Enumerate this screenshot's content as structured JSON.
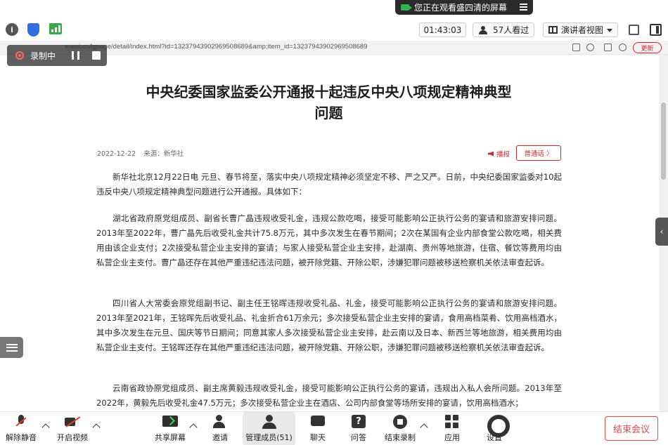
{
  "banner": {
    "text": "您正在观看盛四清的屏幕"
  },
  "header": {
    "timer": "01:43:03",
    "viewers": "57人看过",
    "view_mode": "演讲者视图"
  },
  "browser": {
    "url": "xuexi.cn/lgpage/detail/index.html?id=13237943902969508689&amp;item_id=13237943902969508689",
    "update_label": "更新"
  },
  "recording": {
    "label": "录制中"
  },
  "article": {
    "title_line1": "中央纪委国家监委公开通报十起违反中央八项规定精神典型",
    "title_line2": "问题",
    "date": "2022-12-22",
    "source": "来源：新华社",
    "audio_label": "播报",
    "mandarin_label": "普通话 〉",
    "paragraphs": [
      "新华社北京12月22日电 元旦、春节将至，落实中央八项规定精神必须坚定不移、严之又严。日前，中央纪委国家监委对10起违反中央八项规定精神典型问题进行公开通报。具体如下：",
      "湖北省政府原党组成员、副省长曹广晶违规收受礼金，违规公款吃喝，接受可能影响公正执行公务的宴请和旅游安排问题。2013年至2022年，曹广晶先后收受礼金共计75.8万元，其中多次发生在春节期间；2次在某国有企业内部食堂公款吃喝，相关费用由该企业支付；2次接受私营企业主安排的宴请；与家人接受私营企业主安排，赴湖南、贵州等地旅游，住宿、餐饮等费用均由私营企业主支付。曹广晶还存在其他严重违纪违法问题，被开除党籍、开除公职，涉嫌犯罪问题被移送检察机关依法审查起诉。",
      "四川省人大常委会原党组副书记、副主任王铭晖违规收受礼品、礼金，接受可能影响公正执行公务的宴请和旅游安排问题。2013年至2021年，王铭晖先后收受礼品、礼金折合61万余元；多次接受私营企业主安排的宴请，食用高档菜肴、饮用高档酒水，其中多次发生在元旦、国庆等节日期间；同意其家人多次接受私营企业主安排，赴云南以及日本、新西兰等地旅游，相关费用均由私营企业主支付。王铭晖还存在其他严重违纪违法问题，被开除党籍、开除公职，涉嫌犯罪问题被移送检察机关依法审查起诉。",
      "云南省政协原党组成员、副主席黄毅违规收受礼金，接受可能影响公正执行公务的宴请，违规出入私人会所问题。2013年至2022年，黄毅先后收受礼金47.5万元；多次接受私营企业主在酒店、公司内部食堂等场所安排的宴请，饮用高档酒水；"
    ]
  },
  "toolbar": {
    "mute_label": "解除静音",
    "video_label": "开启视频",
    "share_label": "共享屏幕",
    "invite_label": "邀请",
    "members_label": "管理成员(51)",
    "chat_label": "聊天",
    "qa_label": "问答",
    "end_recording_label": "结束录制",
    "apps_label": "应用",
    "settings_label": "设置",
    "end_meeting_label": "结束会议"
  },
  "colors": {
    "accent_red": "#cc2a2a",
    "end_red": "#e24a4a",
    "share_green": "#3fd25a",
    "banner_dark": "#2b2b2b"
  }
}
